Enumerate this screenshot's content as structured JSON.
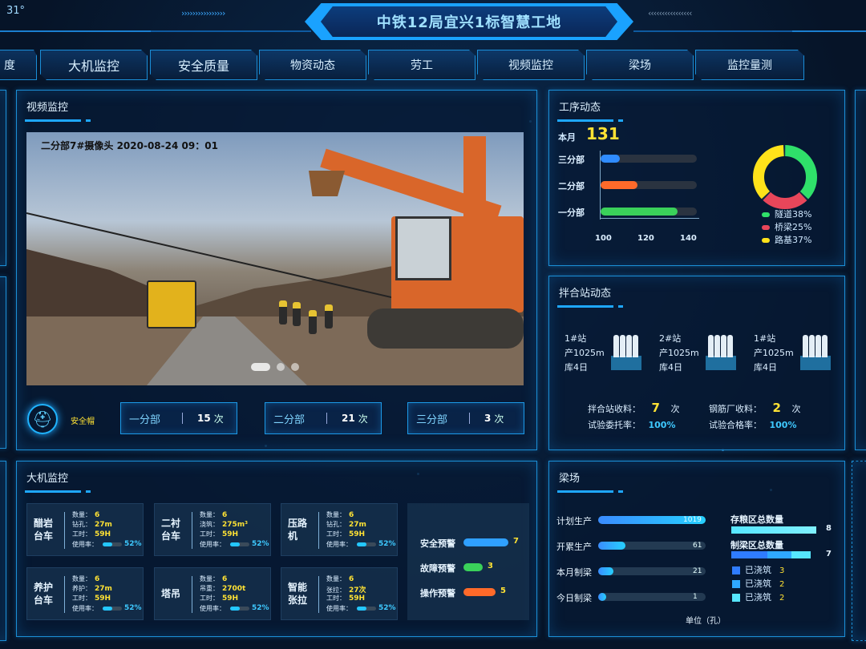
{
  "header": {
    "title": "中铁12局宜兴1标智慧工地",
    "temperature": "31°",
    "chevrons_left": "››››››››››››››››",
    "chevrons_right": "‹‹‹‹‹‹‹‹‹‹‹‹‹‹‹‹"
  },
  "tabs": [
    "进度",
    "大机监控",
    "安全质量",
    "物资动态",
    "劳工",
    "视频监控",
    "梁场",
    "监控量测"
  ],
  "tab_partial": "度",
  "video_panel": {
    "title": "视频监控",
    "caption": "二分部7#摄像头   2020-08-24  09：01",
    "helmet_label": "安全帽",
    "counts": [
      {
        "name": "一分部",
        "value": "15",
        "unit": "次"
      },
      {
        "name": "二分部",
        "value": "21",
        "unit": "次"
      },
      {
        "name": "三分部",
        "value": "3",
        "unit": "次"
      }
    ]
  },
  "process_panel": {
    "title": "工序动态",
    "month_label": "本月",
    "month_value": "131",
    "rows": [
      {
        "label": "三分部",
        "value": 110,
        "color": "#2f8cff"
      },
      {
        "label": "二分部",
        "value": 119,
        "color": "#ff6a2a"
      },
      {
        "label": "一分部",
        "value": 140,
        "color": "#3ad15a"
      }
    ],
    "axis_ticks": [
      "100",
      "120",
      "140"
    ],
    "donut": [
      {
        "label": "隧道38%",
        "value": 38,
        "color": "#2fe06a"
      },
      {
        "label": "桥梁25%",
        "value": 25,
        "color": "#e8465a"
      },
      {
        "label": "路基37%",
        "value": 37,
        "color": "#ffe21a"
      }
    ]
  },
  "mixing_panel": {
    "title": "拌合站动态",
    "stations": [
      {
        "name": "1#站",
        "output": "产1025m",
        "stock": "库4日"
      },
      {
        "name": "2#站",
        "output": "产1025m",
        "stock": "库4日"
      },
      {
        "name": "1#站",
        "output": "产1025m",
        "stock": "库4日"
      }
    ],
    "mix_receive_label": "拌合站收料：",
    "mix_receive_value": "7",
    "steel_receive_label": "钢筋厂收料：",
    "steel_receive_value": "2",
    "unit_times": "次",
    "test_commission_label": "试验委托率：",
    "test_commission_value": "100%",
    "test_pass_label": "试验合格率：",
    "test_pass_value": "100%"
  },
  "machine_panel": {
    "title": "大机监控",
    "cards": [
      {
        "name": [
          "醋岩",
          "台车"
        ],
        "rows": [
          [
            "数量：",
            "6"
          ],
          [
            "钻孔：",
            "27m"
          ],
          [
            "工时：",
            "59H"
          ]
        ],
        "usage_label": "使用率：",
        "usage": 52
      },
      {
        "name": [
          "二衬",
          "台车"
        ],
        "rows": [
          [
            "数量：",
            "6"
          ],
          [
            "浇筑：",
            "275m³"
          ],
          [
            "工时：",
            "59H"
          ]
        ],
        "usage_label": "使用率：",
        "usage": 52
      },
      {
        "name": [
          "压路",
          "机"
        ],
        "rows": [
          [
            "数量：",
            "6"
          ],
          [
            "钻孔：",
            "27m"
          ],
          [
            "工时：",
            "59H"
          ]
        ],
        "usage_label": "使用率：",
        "usage": 52
      },
      {
        "name": [
          "养护",
          "台车"
        ],
        "rows": [
          [
            "数量：",
            "6"
          ],
          [
            "养护：",
            "27m"
          ],
          [
            "工时：",
            "59H"
          ]
        ],
        "usage_label": "使用率：",
        "usage": 52
      },
      {
        "name": [
          "塔吊"
        ],
        "rows": [
          [
            "数量：",
            "6"
          ],
          [
            "吊重：",
            "2700t"
          ],
          [
            "工时：",
            "59H"
          ]
        ],
        "usage_label": "使用率：",
        "usage": 52
      },
      {
        "name": [
          "智能",
          "张拉"
        ],
        "rows": [
          [
            "数量：",
            "6"
          ],
          [
            "张拉：",
            "27次"
          ],
          [
            "工时：",
            "59H"
          ]
        ],
        "usage_label": "使用率：",
        "usage": 52
      }
    ],
    "pct_suffix": "%",
    "warnings": [
      {
        "label": "安全预警",
        "value": 7,
        "color": "#2fa0ff"
      },
      {
        "label": "故障预警",
        "value": 3,
        "color": "#3ad15a"
      },
      {
        "label": "操作预警",
        "value": 5,
        "color": "#ff6a2a"
      }
    ]
  },
  "beam_panel": {
    "title": "梁场",
    "rows": [
      {
        "label": "计划生产",
        "value": 1019,
        "fraction": 1.0
      },
      {
        "label": "开累生产",
        "value": 61,
        "fraction": 0.25
      },
      {
        "label": "本月制梁",
        "value": 21,
        "fraction": 0.14
      },
      {
        "label": "今日制梁",
        "value": 1,
        "fraction": 0.06
      }
    ],
    "storage_label": "存粮区总数量",
    "storage_value": "8",
    "making_label": "制梁区总数量",
    "making_value": "7",
    "poured": [
      {
        "label": "已浇筑",
        "value": "3",
        "color": "#2f7cff"
      },
      {
        "label": "已浇筑",
        "value": "2",
        "color": "#2fa8ff"
      },
      {
        "label": "已浇筑",
        "value": "2",
        "color": "#56e6ff"
      }
    ],
    "unit_label": "单位（孔）"
  }
}
